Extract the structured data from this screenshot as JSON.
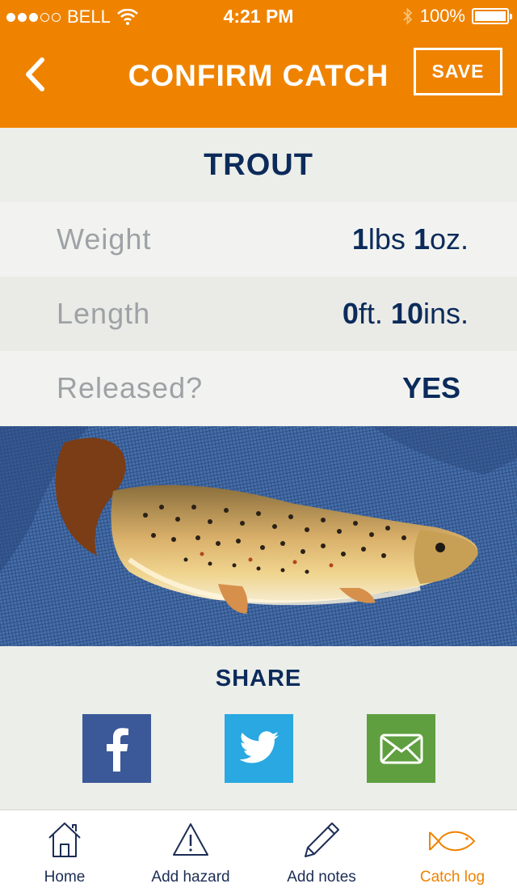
{
  "status_bar": {
    "carrier": "BELL",
    "time": "4:21 PM",
    "battery": "100%"
  },
  "nav": {
    "title": "CONFIRM CATCH",
    "save_label": "SAVE"
  },
  "catch": {
    "species": "TROUT",
    "weight": {
      "label": "Weight",
      "lbs": "1",
      "lbs_unit": "lbs",
      "oz": "1",
      "oz_unit": "oz."
    },
    "length": {
      "label": "Length",
      "ft": "0",
      "ft_unit": "ft.",
      "ins": "10",
      "ins_unit": "ins."
    },
    "released": {
      "label": "Released?",
      "value": "YES"
    }
  },
  "share": {
    "title": "SHARE",
    "buttons": [
      {
        "name": "facebook",
        "color": "#3b5998"
      },
      {
        "name": "twitter",
        "color": "#29a8e1"
      },
      {
        "name": "email",
        "color": "#5f9f3f"
      }
    ]
  },
  "tabbar": {
    "items": [
      {
        "label": "Home",
        "icon": "home-icon"
      },
      {
        "label": "Add hazard",
        "icon": "warning-icon"
      },
      {
        "label": "Add notes",
        "icon": "pencil-icon"
      },
      {
        "label": "Catch log",
        "icon": "fish-icon",
        "active": true
      }
    ]
  },
  "colors": {
    "brand_orange": "#ef8300",
    "navy": "#0c2b5b",
    "label_grey": "#9ea2a6"
  }
}
